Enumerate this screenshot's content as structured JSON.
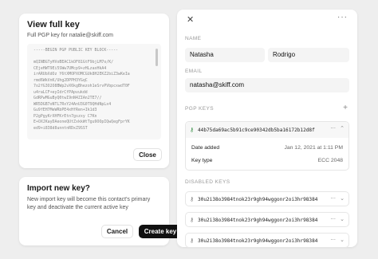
{
  "view_key": {
    "title": "View full key",
    "subtitle": "Full PGP key for natalie@skiff.com",
    "key_lines": [
      "-----BEGIN PGP PUBLIC KEY BLOCK-----",
      "",
      "mQINBGTyHVoBEAC1kOF81GtF9bjLM7o/K/",
      "CEjeHWT9Ei5SWw7UMcp9+zHLzaxHkA4",
      "irARUbXdOz Y6tXMOPXOMCGUk8H2EKZ2biZ3wKeIa",
      "rmd6WkVnK/Uhg2DPPH3YGqC",
      "7o2fG3O2O8BWp2vX6kgBhezoh1eSrvPVbpcxwdT0F",
      "u4raLCF+eyIdrCfPApvukdd",
      "GdRPwMGuByQ0twI9nN4ZIAn2TE7//",
      "WR5DGB7oNTL7RxY24AnU3G0T9QHdNpLx4",
      "Gu9fEH7MeWRbPE4xHfRen+Ik1d3",
      "P2gPgyKrXHFKrEtn7gszxy C7Kn",
      "E+OXJKayDAeoneQUtZxkkWtTgu9OOpIQwQegFprYK",
      "ed9+i838d8unntnRDxZ9SST"
    ],
    "close_label": "Close"
  },
  "import_key": {
    "title": "Import new key?",
    "body": "New import key will become this contact's primary key and deactivate the current active key",
    "cancel_label": "Cancel",
    "create_label": "Create key"
  },
  "contact": {
    "close_icon": "✕",
    "more_icon": "···",
    "name_label": "NAME",
    "first_name": "Natasha",
    "last_name": "Rodrigo",
    "email_label": "EMAIL",
    "email": "natasha@skiff.com",
    "pgp_label": "PGP KEYS",
    "add_icon": "+",
    "active_key": {
      "fingerprint": "44b75da69ac5b91c9ce90342db5ba16172b12d8f",
      "date_added_label": "Date added",
      "date_added": "Jan 12, 2021 at 1:11 PM",
      "key_type_label": "Key type",
      "key_type": "ECC 2048"
    },
    "disabled_label": "DISABLED KEYS",
    "disabled_keys": [
      "30u2i38o3984tnok23r9gh94wggonr2oi3hr98384",
      "30u2i38o3984tnok23r9gh94wggonr2oi3hr98384",
      "30u2i38o3984tnok23r9gh94wggonr2oi3hr98384"
    ]
  },
  "icons": {
    "key": "key-icon",
    "more": "more-icon",
    "chevron": "chevron-down-icon"
  },
  "colors": {
    "primary_button": "#111111",
    "active_key_icon": "#2e8b3e",
    "background": "#eeeeee"
  }
}
